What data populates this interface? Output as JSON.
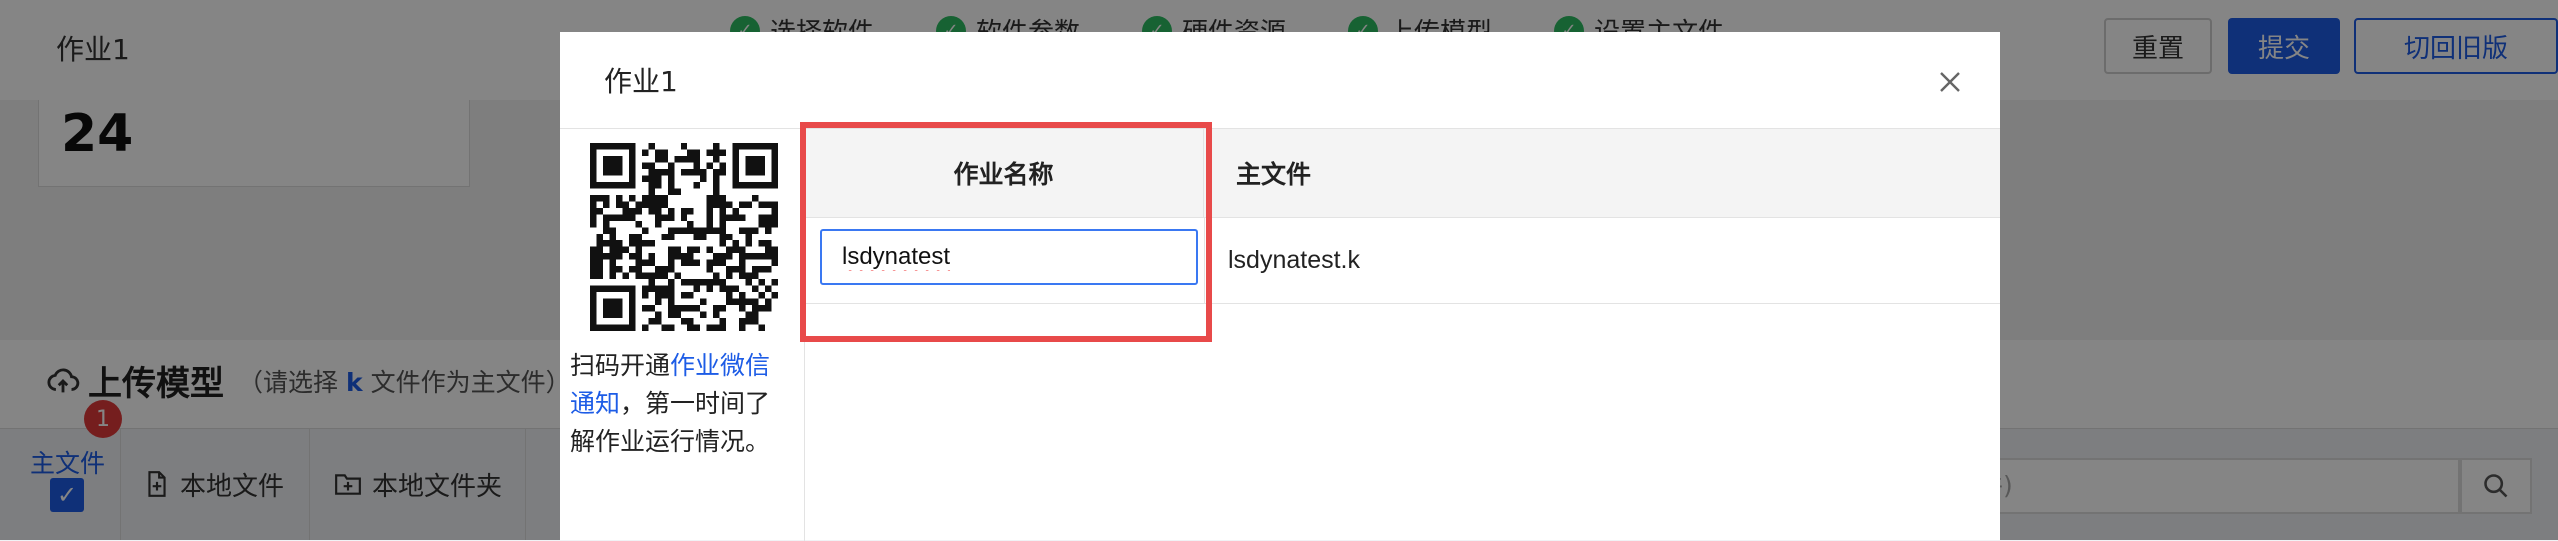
{
  "background": {
    "title": "作业1",
    "steps": [
      "选择软件",
      "软件参数",
      "硬件资源",
      "上传模型",
      "设置主文件"
    ],
    "buttons": {
      "reset": "重置",
      "submit": "提交",
      "old_version": "切回旧版"
    },
    "stat_value": "24",
    "upload": {
      "title": "上传模型",
      "hint_prefix": "（请选择",
      "hint_k": "k",
      "hint_suffix": "文件作为主文件）"
    },
    "main_file_label": "主文件",
    "badge_count": "1",
    "tools": {
      "local_file": "本地文件",
      "local_folder": "本地文件夹"
    },
    "search_placeholder": "件)"
  },
  "modal": {
    "title": "作业1",
    "qr_text_1": "扫码开通",
    "qr_link": "作业微信通知",
    "qr_text_2": "，第一时间了解作业运行情况。",
    "table": {
      "headers": {
        "job_name": "作业名称",
        "main_file": "主文件"
      },
      "row": {
        "job_name": "lsdynatest",
        "main_file": "lsdynatest.k"
      }
    }
  },
  "colors": {
    "accent": "#1d5ce6",
    "step_check": "#2dbd63",
    "highlight": "#e84a4a",
    "badge": "#e03b3b"
  }
}
